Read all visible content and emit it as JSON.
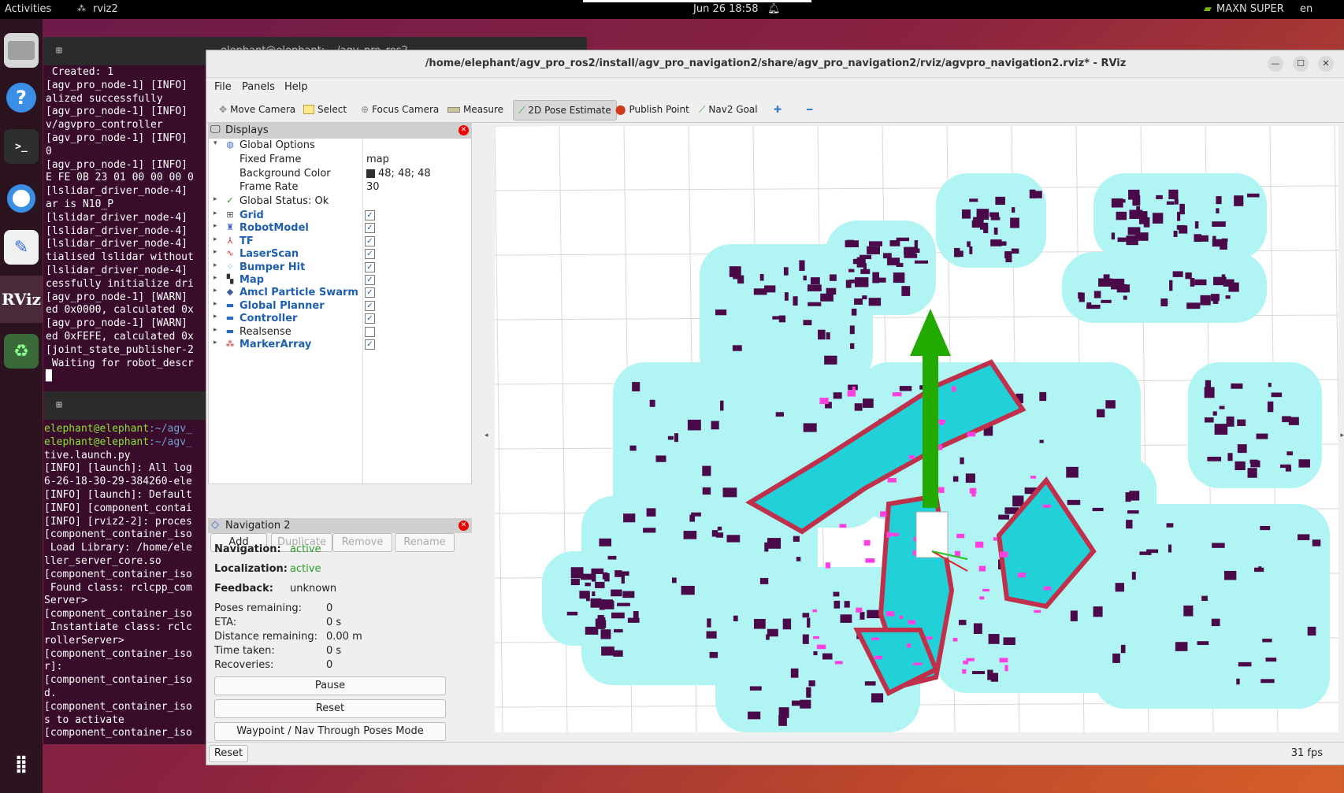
{
  "topbar": {
    "activities": "Activities",
    "app": "rviz2",
    "clock": "Jun 26  18:58",
    "power_mode": "MAXN SUPER",
    "lang": "en"
  },
  "dock": {
    "rviz_label": "RViz"
  },
  "terminal1": {
    "title": "elephant@elephant: ~/agv_pro_ros2",
    "lines": [
      " Created: 1",
      "[agv_pro_node-1] [INFO]",
      "alized successfully",
      "[agv_pro_node-1] [INFO]",
      "v/agvpro_controller",
      "[agv_pro_node-1] [INFO]",
      "0",
      "[agv_pro_node-1] [INFO]",
      "E FE 0B 23 01 00 00 00 0",
      "[lslidar_driver_node-4]",
      "ar is N10_P",
      "[lslidar_driver_node-4]",
      "[lslidar_driver_node-4]",
      "[lslidar_driver_node-4]",
      "tialised lslidar without",
      "[lslidar_driver_node-4]",
      "cessfully initialize dri",
      "[agv_pro_node-1] [WARN]",
      "ed 0x0000, calculated 0x",
      "[agv_pro_node-1] [WARN]",
      "ed 0xFEFE, calculated 0x",
      "[joint_state_publisher-2",
      " Waiting for robot_descr",
      "█"
    ]
  },
  "terminal2": {
    "prompt_user": "elephant@elephant",
    "prompt_path": ":~/agv_",
    "lines": [
      "tive.launch.py",
      "[INFO] [launch]: All log",
      "6-26-18-30-29-384260-ele",
      "[INFO] [launch]: Default",
      "[INFO] [component_contai",
      "[INFO] [rviz2-2]: proces",
      "[component_container_iso",
      " Load Library: /home/ele",
      "ller_server_core.so",
      "[component_container_iso",
      " Found class: rclcpp_com",
      "Server>",
      "[component_container_iso",
      " Instantiate class: rclc",
      "rollerServer>",
      "[component_container_iso",
      "r]:",
      "[component_container_iso",
      "d.",
      "[component_container_iso",
      "s to activate",
      "[component_container_iso"
    ]
  },
  "rviz": {
    "title": "/home/elephant/agv_pro_ros2/install/agv_pro_navigation2/share/agv_pro_navigation2/rviz/agvpro_navigation2.rviz* - RViz",
    "menu": [
      "File",
      "Panels",
      "Help"
    ],
    "tools": [
      "Move Camera",
      "Select",
      "Focus Camera",
      "Measure",
      "2D Pose Estimate",
      "Publish Point",
      "Nav2 Goal"
    ],
    "displays": {
      "header": "Displays",
      "global_options": "Global Options",
      "fixed_frame_label": "Fixed Frame",
      "fixed_frame_value": "map",
      "bg_color_label": "Background Color",
      "bg_color_value": "48; 48; 48",
      "frame_rate_label": "Frame Rate",
      "frame_rate_value": "30",
      "global_status": "Global Status: Ok",
      "items": [
        {
          "name": "Grid",
          "checked": true
        },
        {
          "name": "RobotModel",
          "checked": true
        },
        {
          "name": "TF",
          "checked": true
        },
        {
          "name": "LaserScan",
          "checked": true
        },
        {
          "name": "Bumper Hit",
          "checked": true
        },
        {
          "name": "Map",
          "checked": true
        },
        {
          "name": "Amcl Particle Swarm",
          "checked": true
        },
        {
          "name": "Global Planner",
          "checked": true
        },
        {
          "name": "Controller",
          "checked": true
        },
        {
          "name": "Realsense",
          "checked": false
        },
        {
          "name": "MarkerArray",
          "checked": true
        }
      ],
      "buttons": [
        "Add",
        "Duplicate",
        "Remove",
        "Rename"
      ]
    },
    "nav2": {
      "header": "Navigation 2",
      "navigation_label": "Navigation:",
      "navigation_value": "active",
      "localization_label": "Localization:",
      "localization_value": "active",
      "feedback_label": "Feedback:",
      "feedback_value": "unknown",
      "poses_label": "Poses remaining:",
      "poses_value": "0",
      "eta_label": "ETA:",
      "eta_value": "0 s",
      "distance_label": "Distance remaining:",
      "distance_value": "0.00 m",
      "time_label": "Time taken:",
      "time_value": "0 s",
      "recoveries_label": "Recoveries:",
      "recoveries_value": "0",
      "pause": "Pause",
      "reset": "Reset",
      "waypoint": "Waypoint / Nav Through Poses Mode"
    },
    "status": {
      "reset": "Reset",
      "fps": "31 fps"
    },
    "colors": {
      "costmap": "#b0f4f4",
      "obstacle": "#4a0a4a",
      "inflation_edge": "#c0304a",
      "high_cost": "#22d0d8",
      "lethal_mark": "#ff40e0",
      "arrow": "#22aa00"
    }
  }
}
